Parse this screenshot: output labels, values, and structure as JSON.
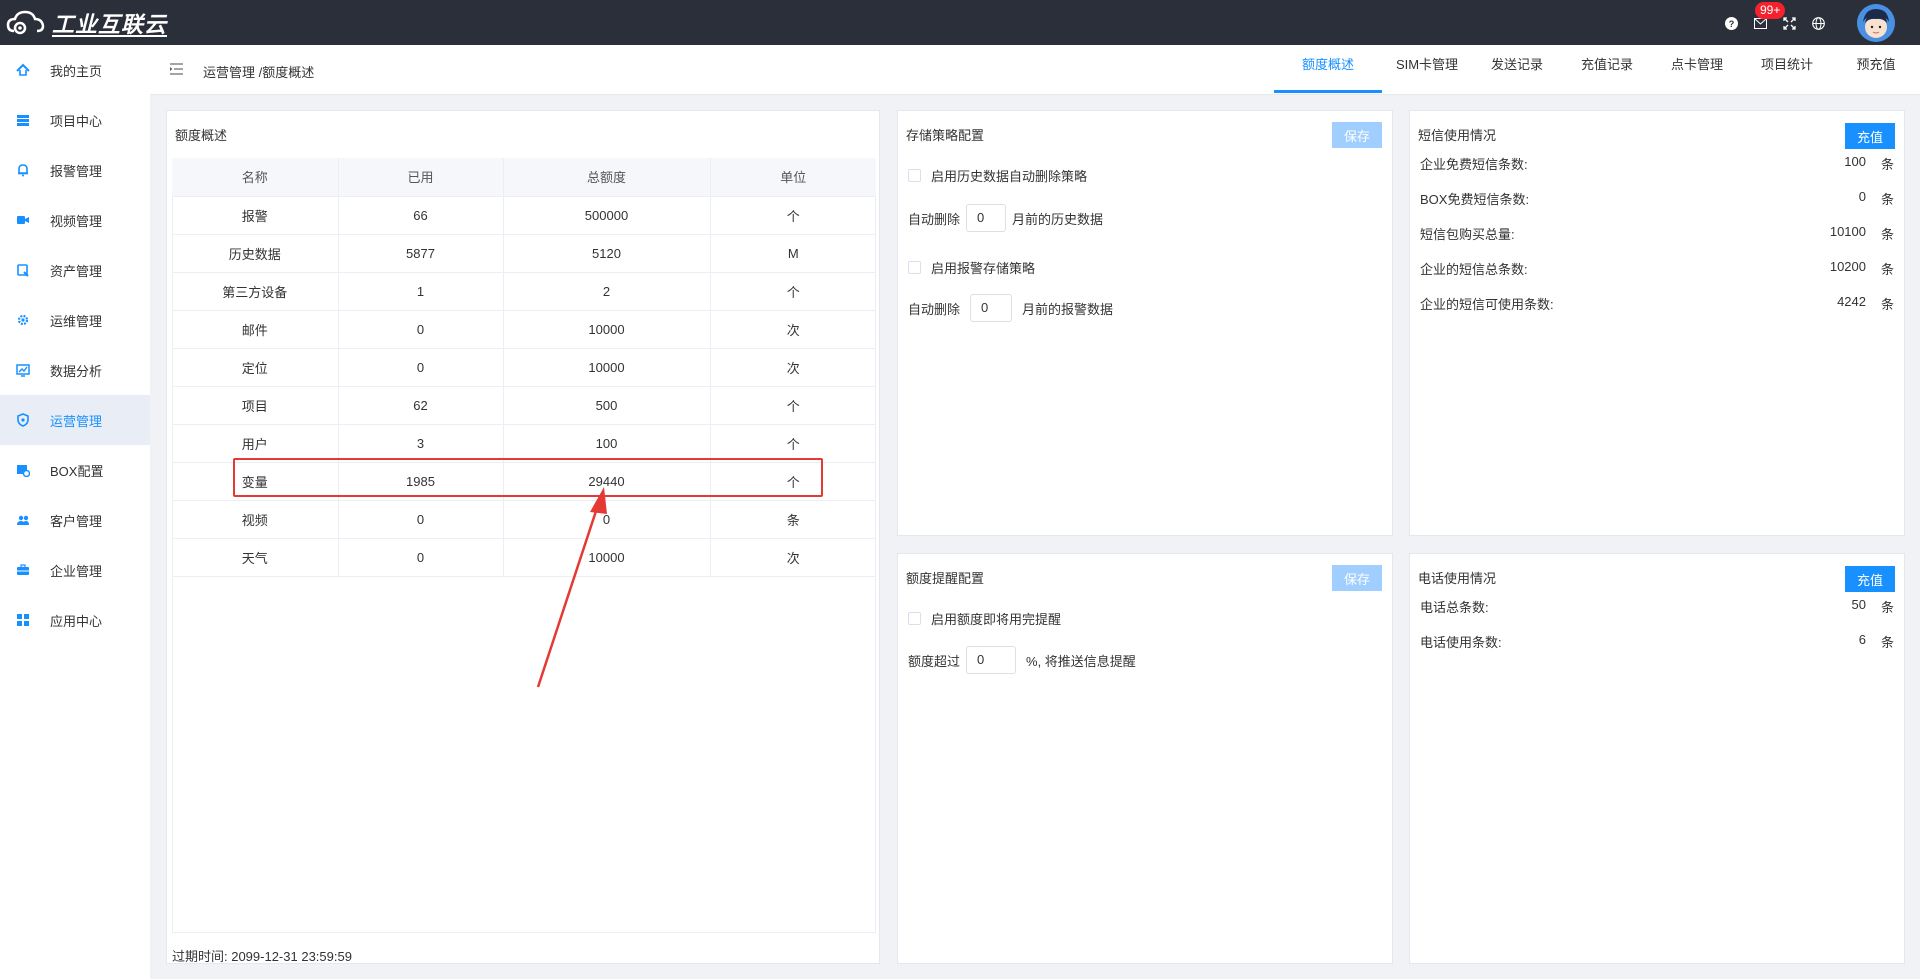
{
  "app": {
    "logo_text": "工业互联云",
    "badge": "99+"
  },
  "sidebar": {
    "items": [
      {
        "label": "我的主页",
        "icon": "home-icon"
      },
      {
        "label": "项目中心",
        "icon": "layers-icon"
      },
      {
        "label": "报警管理",
        "icon": "bell-icon"
      },
      {
        "label": "视频管理",
        "icon": "video-icon"
      },
      {
        "label": "资产管理",
        "icon": "asset-icon"
      },
      {
        "label": "运维管理",
        "icon": "gear-icon"
      },
      {
        "label": "数据分析",
        "icon": "chart-icon"
      },
      {
        "label": "运营管理",
        "icon": "shield-icon"
      },
      {
        "label": "BOX配置",
        "icon": "box-icon"
      },
      {
        "label": "客户管理",
        "icon": "users-icon"
      },
      {
        "label": "企业管理",
        "icon": "briefcase-icon"
      },
      {
        "label": "应用中心",
        "icon": "grid-icon"
      }
    ],
    "active_index": 7
  },
  "header": {
    "breadcrumb": "运营管理 /额度概述",
    "tabs": [
      "额度概述",
      "SIM卡管理",
      "发送记录",
      "充值记录",
      "点卡管理",
      "项目统计",
      "预充值"
    ],
    "active_tab": 0
  },
  "quota": {
    "title": "额度概述",
    "columns": [
      "名称",
      "已用",
      "总额度",
      "单位"
    ],
    "rows": [
      [
        "报警",
        "66",
        "500000",
        "个"
      ],
      [
        "历史数据",
        "5877",
        "5120",
        "M"
      ],
      [
        "第三方设备",
        "1",
        "2",
        "个"
      ],
      [
        "邮件",
        "0",
        "10000",
        "次"
      ],
      [
        "定位",
        "0",
        "10000",
        "次"
      ],
      [
        "项目",
        "62",
        "500",
        "个"
      ],
      [
        "用户",
        "3",
        "100",
        "个"
      ],
      [
        "变量",
        "1985",
        "29440",
        "个"
      ],
      [
        "视频",
        "0",
        "0",
        "条"
      ],
      [
        "天气",
        "0",
        "10000",
        "次"
      ]
    ],
    "expire_text": "过期时间: 2099-12-31 23:59:59"
  },
  "storage": {
    "title": "存储策略配置",
    "save_label": "保存",
    "history_check": "启用历史数据自动删除策略",
    "auto_delete_prefix": "自动删除",
    "history_value": "0",
    "history_suffix": "月前的历史数据",
    "alarm_check": "启用报警存储策略",
    "alarm_value": "0",
    "alarm_suffix": "月前的报警数据"
  },
  "reminder": {
    "title": "额度提醒配置",
    "save_label": "保存",
    "check_label": "启用额度即将用完提醒",
    "prefix": "额度超过",
    "value": "0",
    "suffix": "%, 将推送信息提醒"
  },
  "sms": {
    "title": "短信使用情况",
    "charge_label": "充值",
    "rows": [
      {
        "label": "企业免费短信条数:",
        "value": "100",
        "unit": "条"
      },
      {
        "label": "BOX免费短信条数:",
        "value": "0",
        "unit": "条"
      },
      {
        "label": "短信包购买总量:",
        "value": "10100",
        "unit": "条"
      },
      {
        "label": "企业的短信总条数:",
        "value": "10200",
        "unit": "条"
      },
      {
        "label": "企业的短信可使用条数:",
        "value": "4242",
        "unit": "条"
      }
    ]
  },
  "phone": {
    "title": "电话使用情况",
    "charge_label": "充值",
    "rows": [
      {
        "label": "电话总条数:",
        "value": "50",
        "unit": "条"
      },
      {
        "label": "电话使用条数:",
        "value": "6",
        "unit": "条"
      }
    ]
  },
  "colors": {
    "accent": "#1890ff",
    "annotation": "#e53935",
    "topbar": "#2b2f3a"
  }
}
